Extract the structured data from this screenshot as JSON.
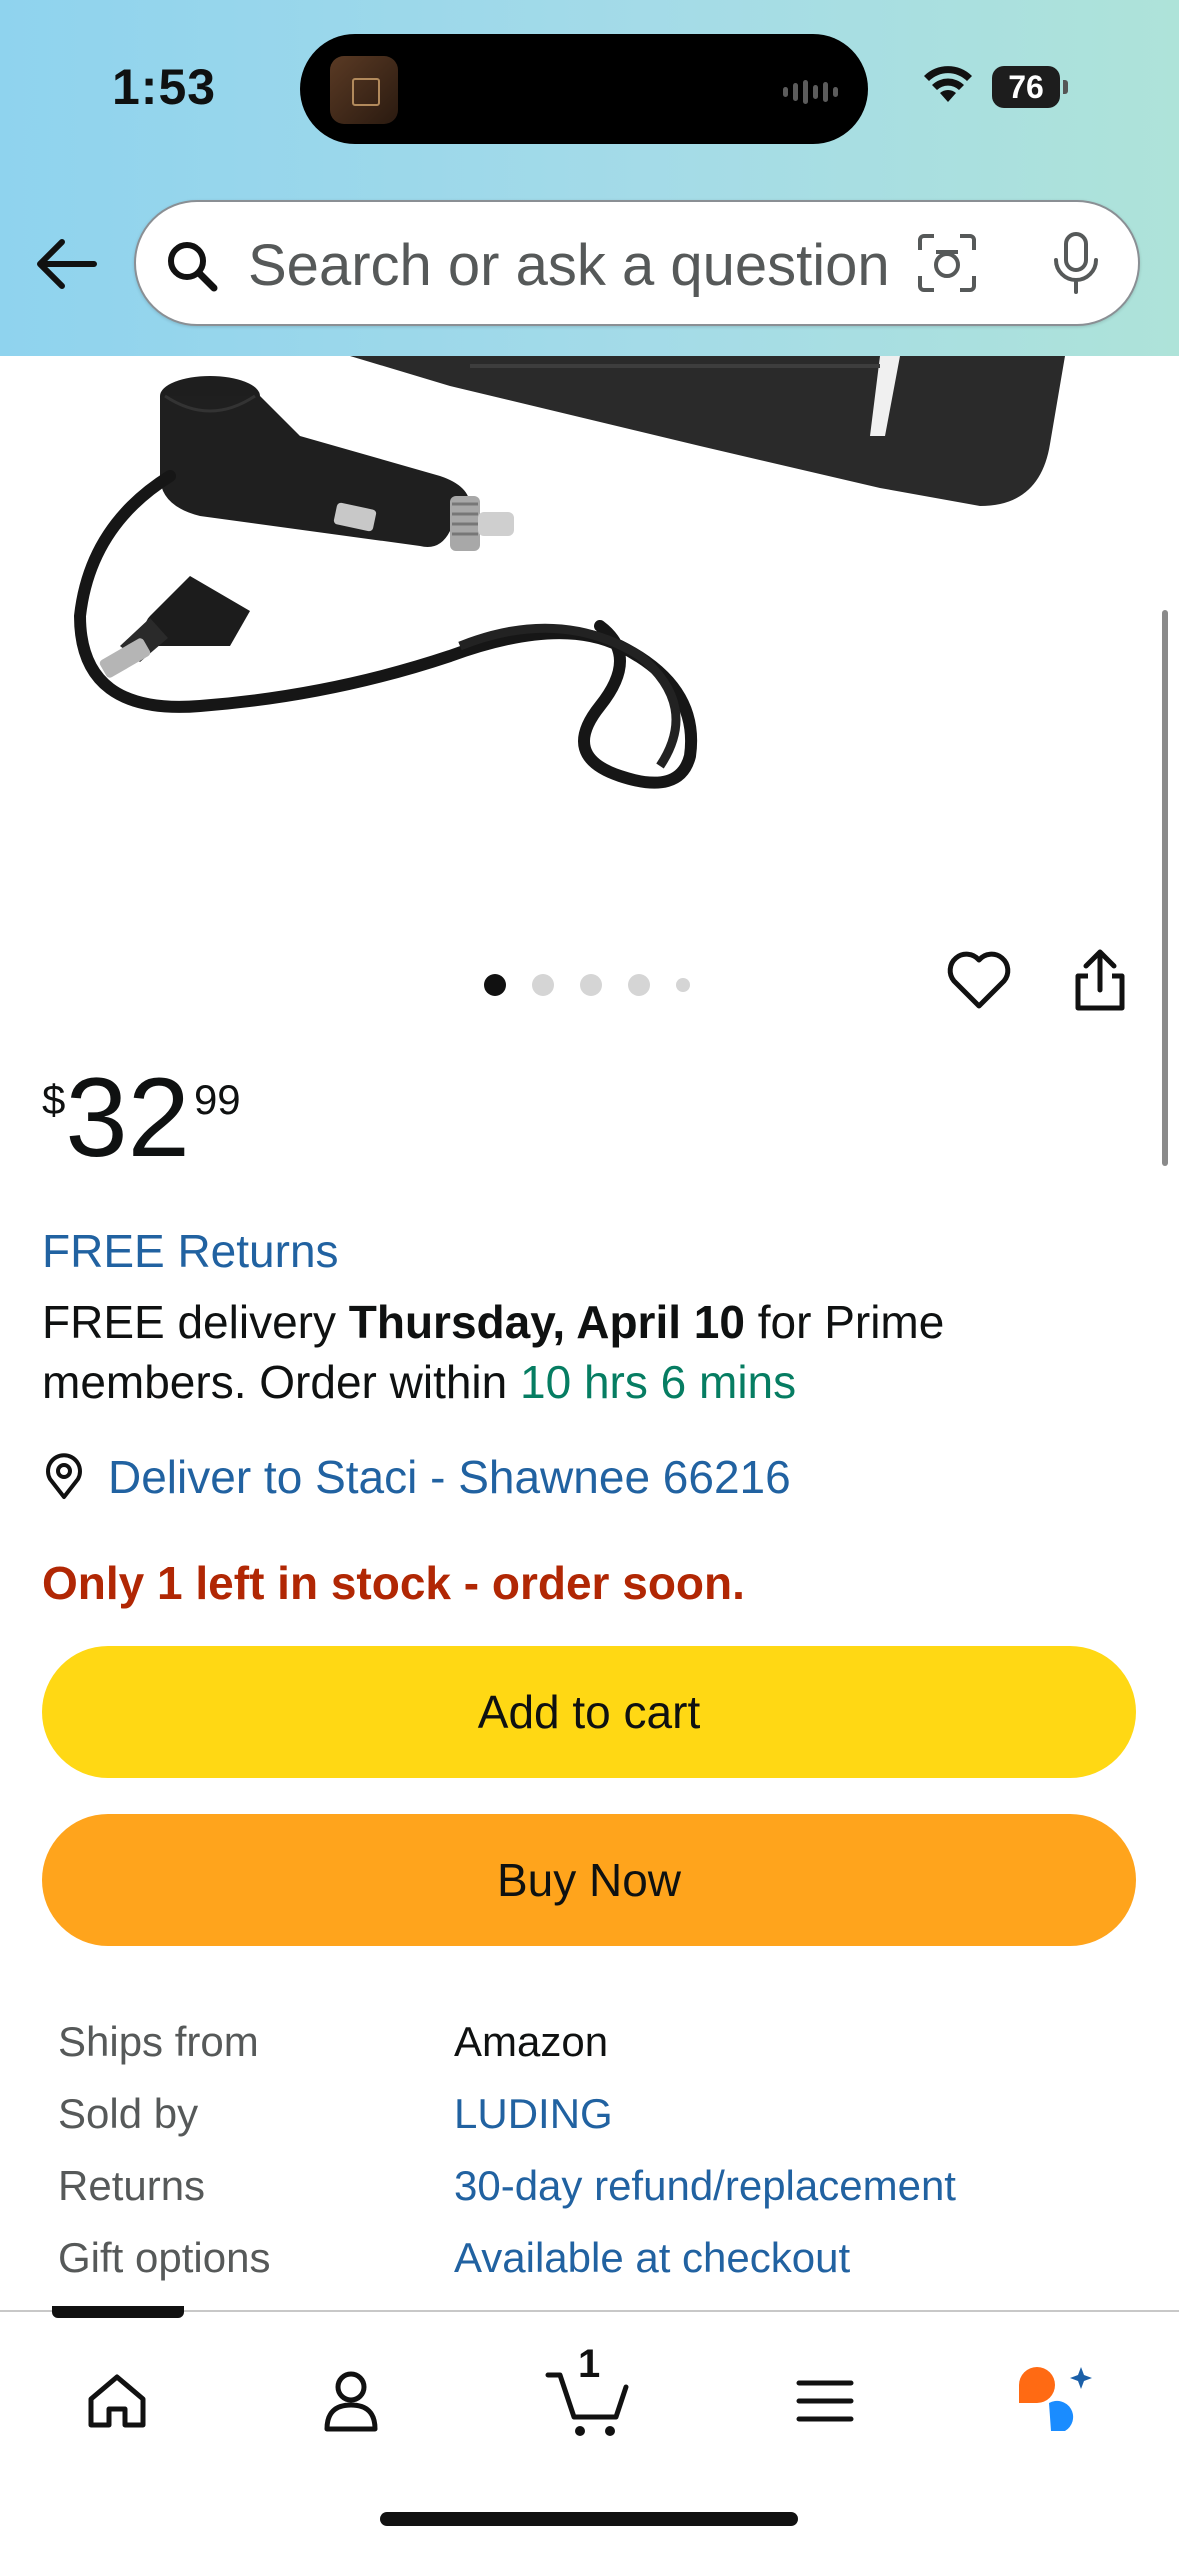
{
  "status_bar": {
    "time": "1:53",
    "battery": "76"
  },
  "search": {
    "placeholder": "Search or ask a question"
  },
  "product": {
    "image_count": 5,
    "active_image": 1,
    "price": {
      "symbol": "$",
      "whole": "32",
      "fraction": "99"
    }
  },
  "delivery": {
    "free_returns": "FREE Returns",
    "line_prefix": "FREE delivery ",
    "date": "Thursday, April 10",
    "line_suffix": " for Prime members. Order within ",
    "countdown": "10 hrs 6 mins",
    "deliver_to": "Deliver to Staci - Shawnee 66216"
  },
  "stock": "Only 1 left in stock - order soon.",
  "buttons": {
    "add_to_cart": "Add to cart",
    "buy_now": "Buy Now"
  },
  "details": [
    {
      "label": "Ships from",
      "value": "Amazon"
    },
    {
      "label": "Sold by",
      "value": "LUDING"
    },
    {
      "label": "Returns",
      "value": "30-day refund/replacement"
    },
    {
      "label": "Gift options",
      "value": "Available at checkout"
    }
  ],
  "nav": {
    "cart_count": "1"
  },
  "colors": {
    "link": "#2162a1",
    "deal_green": "#067d62",
    "stock_red": "#b12704",
    "add_to_cart": "#ffd814",
    "buy_now": "#ffa41c",
    "rufus_orange": "#ff6a13",
    "rufus_blue": "#1a8cff"
  },
  "icons": [
    "back-arrow-icon",
    "search-icon",
    "camera-lens-icon",
    "microphone-icon",
    "heart-icon",
    "share-icon",
    "location-pin-icon",
    "home-icon",
    "account-icon",
    "cart-icon",
    "menu-icon",
    "rufus-chat-icon"
  ]
}
